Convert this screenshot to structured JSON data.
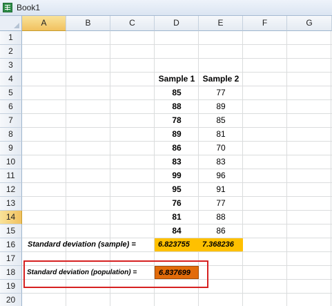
{
  "window": {
    "title": "Book1"
  },
  "columns": [
    "A",
    "B",
    "C",
    "D",
    "E",
    "F",
    "G"
  ],
  "active_column": "A",
  "rows": [
    "1",
    "2",
    "3",
    "4",
    "5",
    "6",
    "7",
    "8",
    "9",
    "10",
    "11",
    "12",
    "13",
    "14",
    "15",
    "16",
    "17",
    "18",
    "19",
    "20"
  ],
  "active_row": "14",
  "sheet": {
    "sample1_header": "Sample 1",
    "sample2_header": "Sample 2",
    "sample1_values": [
      "85",
      "88",
      "78",
      "89",
      "86",
      "83",
      "99",
      "95",
      "76",
      "81",
      "84"
    ],
    "sample2_values": [
      "77",
      "89",
      "85",
      "81",
      "70",
      "83",
      "96",
      "91",
      "77",
      "88",
      "86"
    ],
    "stdev_sample_label": "Standard deviation (sample)   =",
    "stdev_sample_values": [
      "6.823755",
      "7.368236"
    ],
    "stdev_population_label": "Standard deviation    (population)   =",
    "stdev_population_value": "6.837699"
  },
  "colors": {
    "yellow_fill": "#ffc000",
    "orange_fill": "#e26b0a",
    "annotation_red": "#d62020",
    "selected_header": "#f1c15f"
  }
}
